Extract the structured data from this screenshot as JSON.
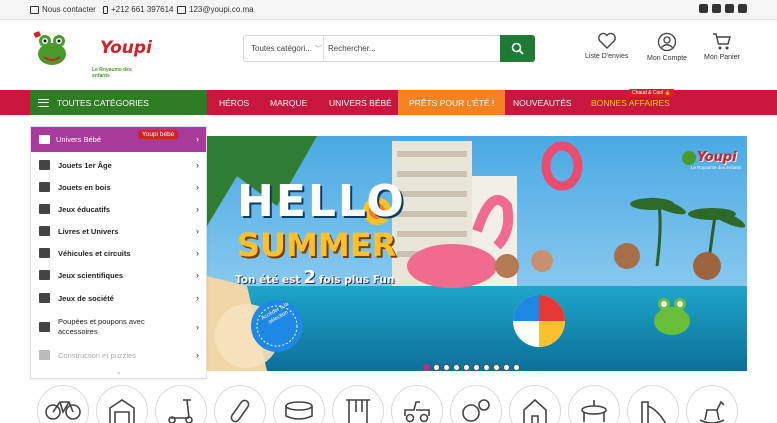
{
  "topbar": {
    "contact": "Nous contacter",
    "phone": "+212 661 397614",
    "email": "123@youpi.co.ma",
    "social_icons": [
      "instagram-icon",
      "facebook-icon",
      "youtube-icon",
      "twitter-icon"
    ]
  },
  "header": {
    "logo_name": "Youpi",
    "logo_tagline": "Le Royaume des enfants",
    "search": {
      "category": "Toutes catégori...",
      "placeholder": "Rechercher..."
    },
    "actions": [
      {
        "label": "Liste D'envies",
        "icon": "heart-icon"
      },
      {
        "label": "Mon Compte",
        "icon": "user-icon"
      },
      {
        "label": "Mon Panier",
        "icon": "cart-icon"
      }
    ]
  },
  "nav": {
    "all_categories": "TOUTES CATÉGORIES",
    "items": [
      "HÉROS",
      "MARQUE",
      "UNIVERS BÉBÉ",
      "PRÊTS POUR L'ÉTÉ !",
      "NOUVEAUTÉS",
      "BONNES AFFAIRES"
    ],
    "badge": "Chaud & Cool 🔥"
  },
  "sidebar": {
    "head": {
      "label": "Univers Bébé",
      "badge": "Youpi bébé"
    },
    "items": [
      "Jouets 1er Âge",
      "Jouets en bois",
      "Jeux éducatifs",
      "Livres et Univers",
      "Véhicules et circuits",
      "Jeux scientifiques",
      "Jeux de société",
      "Poupées et poupons avec accessoires",
      "Construction et puzzles"
    ]
  },
  "banner": {
    "title_line1": "HELLO",
    "title_line2": "SUMMER",
    "subtitle_a": "Ton été est",
    "subtitle_num": "2",
    "subtitle_b": "fois plus Fun",
    "stamp": "Accéder à la sélection",
    "logo": "Youpi",
    "logo_tag": "Le Royaume des enfants",
    "slides": 10,
    "active_slide": 1
  },
  "categories_row": [
    "bicycle-icon",
    "playground-icon",
    "scooter-icon",
    "skateboard-icon",
    "pool-icon",
    "climbing-frame-icon",
    "ride-on-car-icon",
    "balls-icon",
    "playhouse-icon",
    "trampoline-icon",
    "slide-icon",
    "rocking-horse-icon"
  ],
  "colors": {
    "nav_red": "#c8163e",
    "nav_green": "#2f7d23",
    "highlight_orange": "#f58220",
    "sidebar_purple": "#a73a9b",
    "search_green": "#1e7a35"
  }
}
